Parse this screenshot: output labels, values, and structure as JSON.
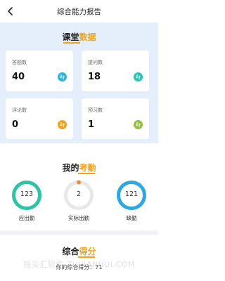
{
  "header": {
    "title": "综合能力报告"
  },
  "classroom": {
    "title_main": "课堂",
    "title_accent": "数据",
    "cards": [
      {
        "label": "答题数",
        "value": "40",
        "icon": "sync-icon",
        "color": "#2bb3d9"
      },
      {
        "label": "提问数",
        "value": "18",
        "icon": "sync-icon",
        "color": "#26c4b3"
      },
      {
        "label": "评论数",
        "value": "0",
        "icon": "sync-icon",
        "color": "#f1a313"
      },
      {
        "label": "预习数",
        "value": "1",
        "icon": "sync-icon",
        "color": "#93c13f"
      }
    ]
  },
  "attendance": {
    "title_main": "我的",
    "title_accent": "考勤",
    "items": [
      {
        "value": "123",
        "label": "应出勤",
        "color": "#2bc4a8"
      },
      {
        "value": "2",
        "label": "实际出勤",
        "color": "#e8e8e8"
      },
      {
        "value": "121",
        "label": "缺勤",
        "color": "#2fa8e0"
      }
    ]
  },
  "score": {
    "title_main": "综合",
    "title_accent": "得分",
    "line": "你的综合得分：71"
  },
  "watermark": "指尖汇软件 ZHIJIANHUI.COM"
}
